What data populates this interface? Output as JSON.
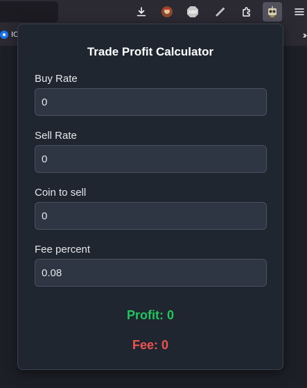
{
  "browser": {
    "bookmark_label": "IC",
    "abp_label": "ABP"
  },
  "popup": {
    "title": "Trade Profit Calculator",
    "fields": [
      {
        "label": "Buy Rate",
        "value": "0"
      },
      {
        "label": "Sell Rate",
        "value": "0"
      },
      {
        "label": "Coin to sell",
        "value": "0"
      },
      {
        "label": "Fee percent",
        "value": "0.08"
      }
    ],
    "profit_text": "Profit: 0",
    "fee_text": "Fee: 0"
  },
  "colors": {
    "profit": "#22c55e",
    "fee": "#ef5350",
    "popup_bg": "#1f2630",
    "input_bg": "#2e3644"
  }
}
